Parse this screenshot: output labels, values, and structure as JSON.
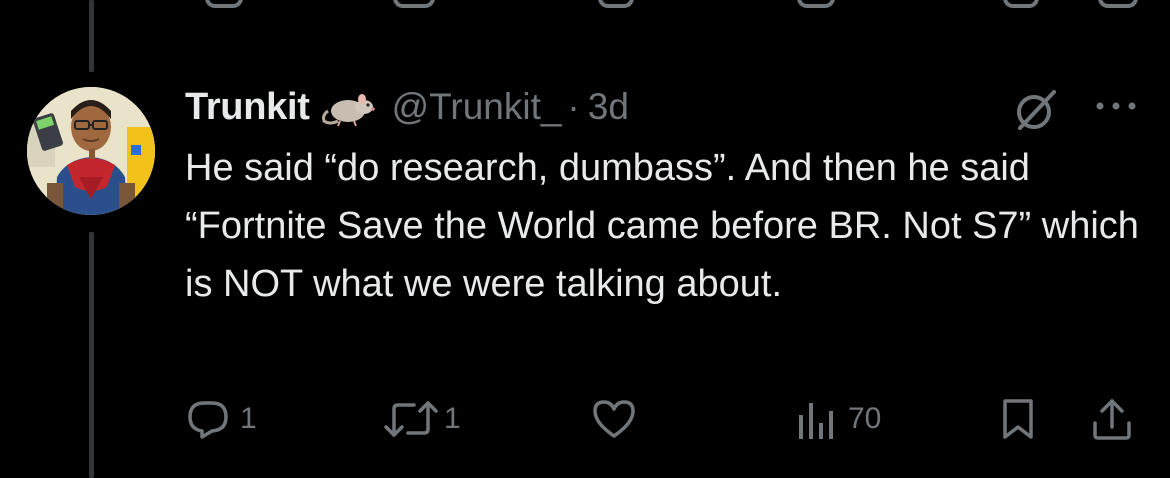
{
  "tweet": {
    "display_name": "Trunkit",
    "name_emoji": "rat",
    "handle": "@Trunkit_",
    "separator": "·",
    "time": "3d",
    "text": "He said “do research, dumbass”. And then he said “Fortnite Save the World came before BR. Not S7” which is NOT what we were talking about."
  },
  "actions": {
    "reply_count": "1",
    "retweet_count": "1",
    "like_count": "",
    "views_count": "70"
  },
  "colors": {
    "background": "#000000",
    "text_primary": "#e7e9ea",
    "text_secondary": "#71767b",
    "thread_line": "#333639"
  },
  "icons": [
    "rat-emoji-icon",
    "grok-icon",
    "more-icon",
    "reply-icon",
    "retweet-icon",
    "like-icon",
    "views-icon",
    "bookmark-icon",
    "share-icon"
  ]
}
